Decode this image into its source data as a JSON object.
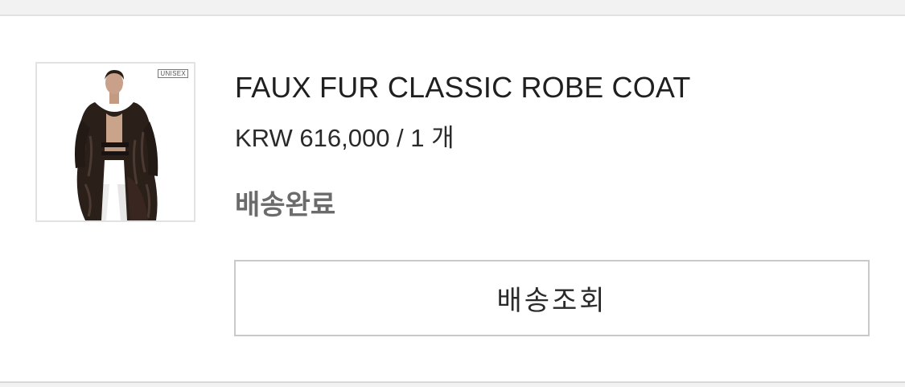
{
  "order_item": {
    "thumbnail": {
      "alt": "Model wearing a long dark faux fur robe coat",
      "tag": "UNISEX"
    },
    "product_name": "FAUX FUR CLASSIC ROBE COAT",
    "price": "KRW 616,000 / 1 개",
    "status": "배송완료",
    "track_button_label": "배송조회"
  }
}
